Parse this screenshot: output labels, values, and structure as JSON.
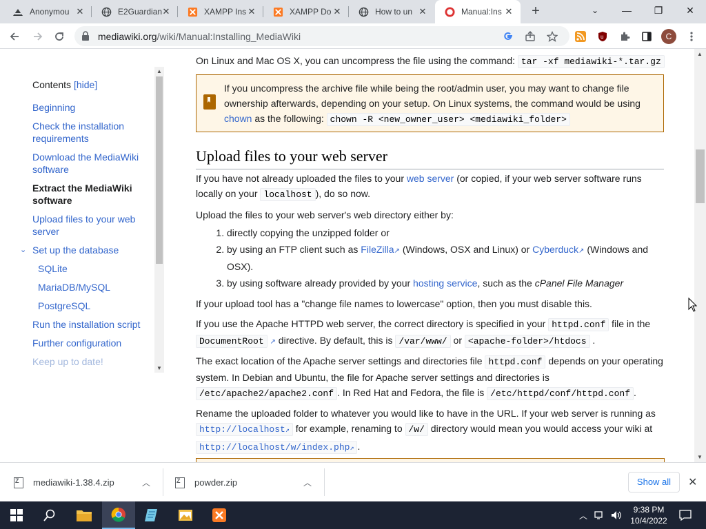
{
  "browser": {
    "tabs": [
      {
        "title": "Anonymou",
        "favicon": "incognito-icon"
      },
      {
        "title": "E2Guardian",
        "favicon": "globe-icon"
      },
      {
        "title": "XAMPP Ins",
        "favicon": "xampp-icon"
      },
      {
        "title": "XAMPP Do",
        "favicon": "xampp-icon"
      },
      {
        "title": "How to un",
        "favicon": "globe-icon"
      },
      {
        "title": "Manual:Ins",
        "favicon": "mediawiki-icon",
        "active": true
      }
    ],
    "url_host": "mediawiki.org",
    "url_path": "/wiki/Manual:Installing_MediaWiki",
    "profile_initial": "C"
  },
  "toc": {
    "heading": "Contents",
    "hide_label": "[hide]",
    "items": [
      {
        "label": "Beginning"
      },
      {
        "label": "Check the installation requirements"
      },
      {
        "label": "Download the MediaWiki software"
      },
      {
        "label": "Extract the MediaWiki software",
        "current": true
      },
      {
        "label": "Upload files to your web server"
      },
      {
        "label": "Set up the database",
        "expanded": true
      },
      {
        "label": "SQLite",
        "sub": true
      },
      {
        "label": "MariaDB/MySQL",
        "sub": true
      },
      {
        "label": "PostgreSQL",
        "sub": true
      },
      {
        "label": "Run the installation script"
      },
      {
        "label": "Further configuration"
      },
      {
        "label": "Keep up to date!"
      }
    ]
  },
  "article": {
    "intro_text": "On Linux and Mac OS X, you can uncompress the file using the command:",
    "intro_code": "tar -xf mediawiki-*.tar.gz",
    "note_text_1": "If you uncompress the archive file while being the root/admin user, you may want to change file ownership afterwards, depending on your setup. On Linux systems, the command would be using",
    "note_link": "chown",
    "note_text_2": "as the following:",
    "note_code": "chown -R <new_owner_user> <mediawiki_folder>",
    "heading": "Upload files to your web server",
    "p1_a": "If you have not already uploaded the files to your",
    "p1_link": "web server",
    "p1_b": "(or copied, if your web server software runs locally on your",
    "p1_code": "localhost",
    "p1_c": "), do so now.",
    "p2": "Upload the files to your web server's web directory either by:",
    "li1": "directly copying the unzipped folder or",
    "li2_a": "by using an FTP client such as",
    "li2_link1": "FileZilla",
    "li2_b": "(Windows, OSX and Linux) or",
    "li2_link2": "Cyberduck",
    "li2_c": "(Windows and OSX).",
    "li3_a": "by using software already provided by your",
    "li3_link": "hosting service",
    "li3_b": ", such as the",
    "li3_em": "cPanel File Manager",
    "p3": "If your upload tool has a \"change file names to lowercase\" option, then you must disable this.",
    "p4_a": "If you use the Apache HTTPD web server, the correct directory is specified in your",
    "p4_code1": "httpd.conf",
    "p4_b": "file in the",
    "p4_code2": "DocumentRoot",
    "p4_c": "directive. By default, this is",
    "p4_code3": "/var/www/",
    "p4_d": "or",
    "p4_code4": "<apache-folder>/htdocs",
    "p4_e": ".",
    "p5_a": "The exact location of the Apache server settings and directories file",
    "p5_code1": "httpd.conf",
    "p5_b": "depends on your operating system. In Debian and Ubuntu, the file for Apache server settings and directories is",
    "p5_code2": "/etc/apache2/apache2.conf",
    "p5_c": ". In Red Hat and Fedora, the file is",
    "p5_code3": "/etc/httpd/conf/httpd.conf",
    "p5_d": ".",
    "p6_a": "Rename the uploaded folder to whatever you would like to have in the URL. If your web server is running as",
    "p6_code1": "http://localhost",
    "p6_b": "for example, renaming to",
    "p6_code2": "/w/",
    "p6_c": "directory would mean you would access your wiki at",
    "p6_code3": "http://localhost/w/index.php",
    "p6_d": "."
  },
  "downloads": {
    "items": [
      {
        "name": "mediawiki-1.38.4.zip"
      },
      {
        "name": "powder.zip"
      }
    ],
    "show_all": "Show all"
  },
  "taskbar": {
    "time": "9:38 PM",
    "date": "10/4/2022"
  },
  "colors": {
    "link": "#3366cc",
    "note_border": "#ac6600",
    "note_bg": "#fef6e7",
    "taskbar": "#1c2333"
  }
}
